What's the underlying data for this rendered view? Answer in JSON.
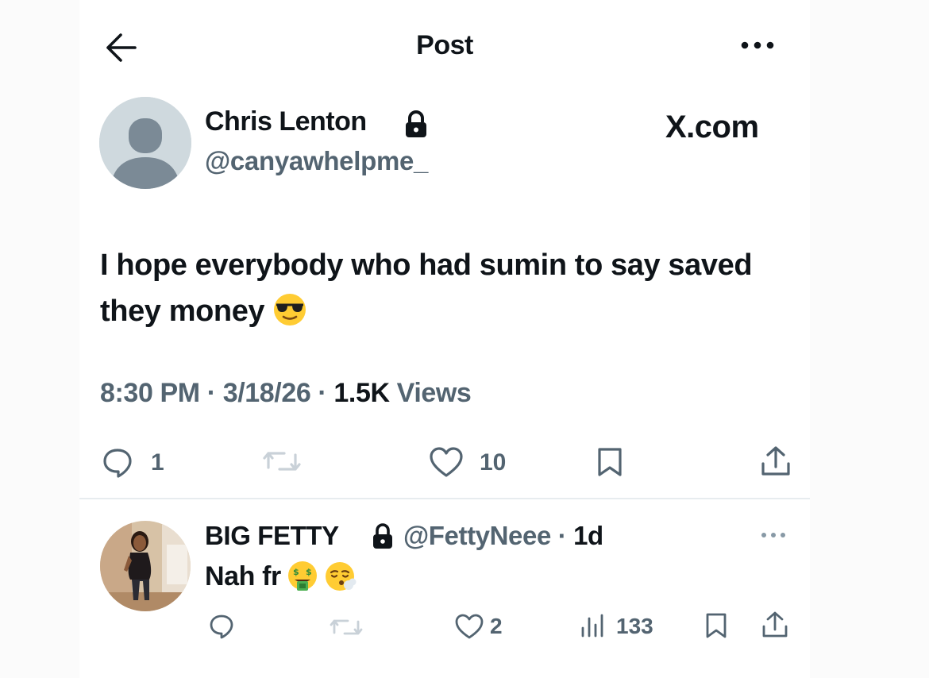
{
  "header": {
    "title": "Post",
    "back_icon": "arrow-left-icon",
    "more_icon": "more-horizontal-icon"
  },
  "post": {
    "author_name": "Chris Lenton",
    "author_handle": "@canyawhelpme_",
    "protected_icon": "lock-icon",
    "source": "X.com",
    "text": "I hope everybody who had sumin to say saved they money",
    "emoji": "smiling-face-with-sunglasses",
    "time": "8:30 PM",
    "date": "3/18/26",
    "views_count": "1.5K",
    "views_label": "Views",
    "separator": "·",
    "actions": {
      "reply_count": "1",
      "repost_count": "",
      "like_count": "10"
    }
  },
  "reply": {
    "author_name": "BIG FETTY",
    "author_handle": "@FettyNeee",
    "age": "1d",
    "text": "Nah fr",
    "emojis": [
      "money-mouth-face",
      "face-exhaling"
    ],
    "actions": {
      "like_count": "2",
      "views_count": "133"
    }
  },
  "colors": {
    "text": "#0f1419",
    "muted": "#536471",
    "divider": "#e7ecef",
    "avatar_bg": "#cfd9de"
  }
}
